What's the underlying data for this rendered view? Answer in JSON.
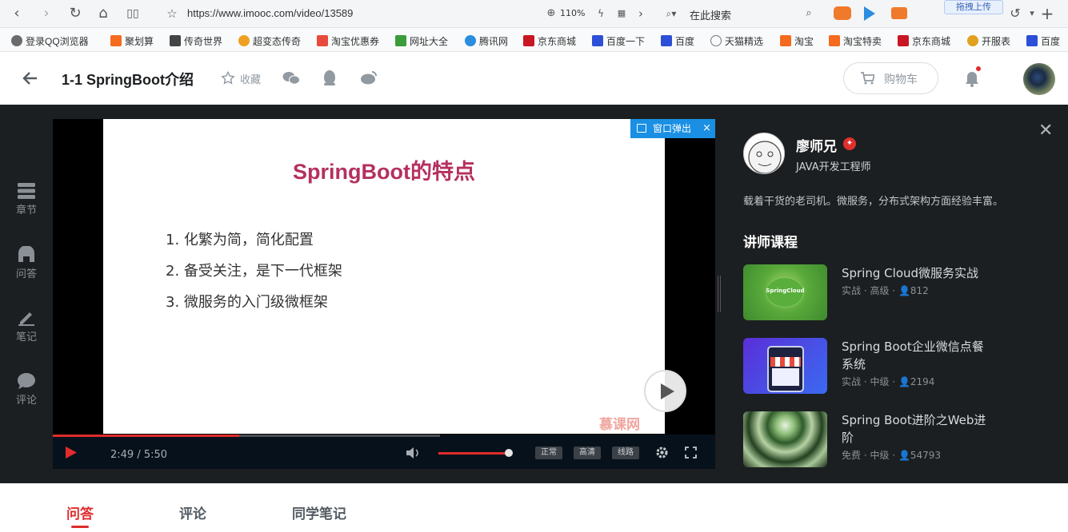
{
  "browser": {
    "url": "https://www.imooc.com/video/13589",
    "zoom": "110%",
    "search_placeholder": "在此搜索",
    "upload_tip": "拖拽上传"
  },
  "bookmarks": [
    {
      "label": "登录QQ浏览器",
      "color": "#6b6b6b"
    },
    {
      "label": "聚划算",
      "color": "#f56a1f"
    },
    {
      "label": "传奇世界",
      "color": "#444444"
    },
    {
      "label": "超变态传奇",
      "color": "#f0a020"
    },
    {
      "label": "淘宝优惠券",
      "color": "#e84b3c"
    },
    {
      "label": "网址大全",
      "color": "#3a9c3a"
    },
    {
      "label": "腾讯网",
      "color": "#2a8de0"
    },
    {
      "label": "京东商城",
      "color": "#c91623"
    },
    {
      "label": "百度一下",
      "color": "#2d4fd8"
    },
    {
      "label": "百度",
      "color": "#2d4fd8"
    },
    {
      "label": "天猫精选",
      "color": "#777777"
    },
    {
      "label": "淘宝",
      "color": "#f56a1f"
    },
    {
      "label": "淘宝特卖",
      "color": "#f56a1f"
    },
    {
      "label": "京东商城",
      "color": "#c91623"
    },
    {
      "label": "开服表",
      "color": "#e0a020"
    },
    {
      "label": "百度",
      "color": "#2d4fd8"
    }
  ],
  "header": {
    "title": "1-1 SpringBoot介绍",
    "favorite_label": "收藏",
    "cart_label": "购物车"
  },
  "sidebar": [
    {
      "label": "章节",
      "icon": "chapter-icon"
    },
    {
      "label": "问答",
      "icon": "qa-icon"
    },
    {
      "label": "笔记",
      "icon": "note-icon"
    },
    {
      "label": "评论",
      "icon": "comment-icon"
    }
  ],
  "video": {
    "slide_title": "SpringBoot的特点",
    "slide_items": [
      "1. 化繁为简，简化配置",
      "2. 备受关注，是下一代框架",
      "3. 微服务的入门级微框架"
    ],
    "watermark": "慕课网",
    "popout_label": "窗口弹出",
    "time": "2:49 / 5:50",
    "progress": 0.48,
    "volume": 0.94,
    "quality_buttons": [
      "正常",
      "高清",
      "线路"
    ]
  },
  "teacher": {
    "name": "廖师兄",
    "title": "JAVA开发工程师",
    "description": "载着干货的老司机。微服务，分布式架构方面经验丰富。",
    "courses_heading": "讲师课程",
    "courses": [
      {
        "title": "Spring Cloud微服务实战",
        "type": "实战",
        "level": "高级",
        "students": "812",
        "thumb_label": "SpringCloud"
      },
      {
        "title": "Spring Boot企业微信点餐系统",
        "type": "实战",
        "level": "中级",
        "students": "2194"
      },
      {
        "title": "Spring Boot进阶之Web进阶",
        "type": "免费",
        "level": "中级",
        "students": "54793"
      }
    ]
  },
  "tabs": [
    {
      "label": "问答",
      "active": true
    },
    {
      "label": "评论",
      "active": false
    },
    {
      "label": "同学笔记",
      "active": false
    }
  ],
  "colors": {
    "accent": "#e02c2c",
    "dark_bg": "#1c1f21",
    "slide_title": "#b5305f",
    "popout": "#1a8fe3"
  }
}
